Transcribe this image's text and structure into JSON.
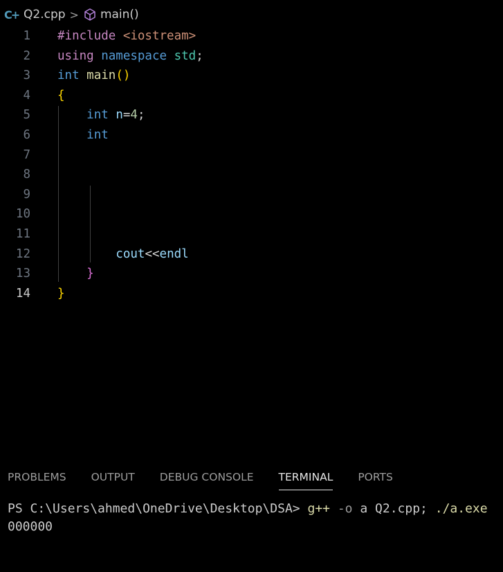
{
  "breadcrumb": {
    "file_icon": "cpp-file-icon",
    "file": "Q2.cpp",
    "separator": ">",
    "symbol_icon": "cube-icon",
    "symbol": "main()"
  },
  "editor": {
    "active_line": "14",
    "lines": [
      {
        "num": "1",
        "tokens": [
          {
            "t": "#include ",
            "c": "#c586c0"
          },
          {
            "t": "<iostream>",
            "c": "#ce9178"
          }
        ]
      },
      {
        "num": "2",
        "tokens": [
          {
            "t": "using ",
            "c": "#c586c0"
          },
          {
            "t": "namespace ",
            "c": "#569cd6"
          },
          {
            "t": "std",
            "c": "#4ec9b0"
          },
          {
            "t": ";",
            "c": "#d4d4d4"
          }
        ]
      },
      {
        "num": "3",
        "tokens": [
          {
            "t": "int ",
            "c": "#569cd6"
          },
          {
            "t": "main",
            "c": "#dcdcaa"
          },
          {
            "t": "()",
            "c": "#ffd700"
          }
        ]
      },
      {
        "num": "4",
        "tokens": [
          {
            "t": "{",
            "c": "#ffd700"
          }
        ]
      },
      {
        "num": "5",
        "tokens": [
          {
            "t": "    ",
            "c": "#d4d4d4"
          },
          {
            "t": "int ",
            "c": "#569cd6"
          },
          {
            "t": "n",
            "c": "#9cdcfe"
          },
          {
            "t": "=",
            "c": "#d4d4d4"
          },
          {
            "t": "4",
            "c": "#b5cea8"
          },
          {
            "t": ";",
            "c": "#d4d4d4"
          }
        ]
      },
      {
        "num": "6",
        "tokens": [
          {
            "t": "    ",
            "c": "#d4d4d4"
          },
          {
            "t": "int ",
            "c": "#569cd6"
          }
        ]
      },
      {
        "num": "7",
        "tokens": []
      },
      {
        "num": "8",
        "tokens": []
      },
      {
        "num": "9",
        "tokens": []
      },
      {
        "num": "10",
        "tokens": []
      },
      {
        "num": "11",
        "tokens": []
      },
      {
        "num": "12",
        "tokens": [
          {
            "t": "        ",
            "c": "#d4d4d4"
          },
          {
            "t": "cout",
            "c": "#9cdcfe"
          },
          {
            "t": "<<",
            "c": "#d4d4d4"
          },
          {
            "t": "endl",
            "c": "#9cdcfe"
          }
        ]
      },
      {
        "num": "13",
        "tokens": [
          {
            "t": "    ",
            "c": "#d4d4d4"
          },
          {
            "t": "}",
            "c": "#da70d6"
          }
        ]
      },
      {
        "num": "14",
        "tokens": [
          {
            "t": "}",
            "c": "#ffd700"
          }
        ]
      }
    ]
  },
  "panel": {
    "tabs": [
      "PROBLEMS",
      "OUTPUT",
      "DEBUG CONSOLE",
      "TERMINAL",
      "PORTS"
    ],
    "active_tab": "TERMINAL"
  },
  "terminal": {
    "prompt": "PS C:\\Users\\ahmed\\OneDrive\\Desktop\\DSA> ",
    "cmd": "g++",
    "flag": " -o",
    "args": " a Q2.cpp; ",
    "run": "./a.exe",
    "output": "000000"
  },
  "colors": {
    "background": "#000000",
    "cmd": "#dcdcaa",
    "flag": "#9d9d9d",
    "args": "#cccccc",
    "run": "#dcdcaa"
  }
}
